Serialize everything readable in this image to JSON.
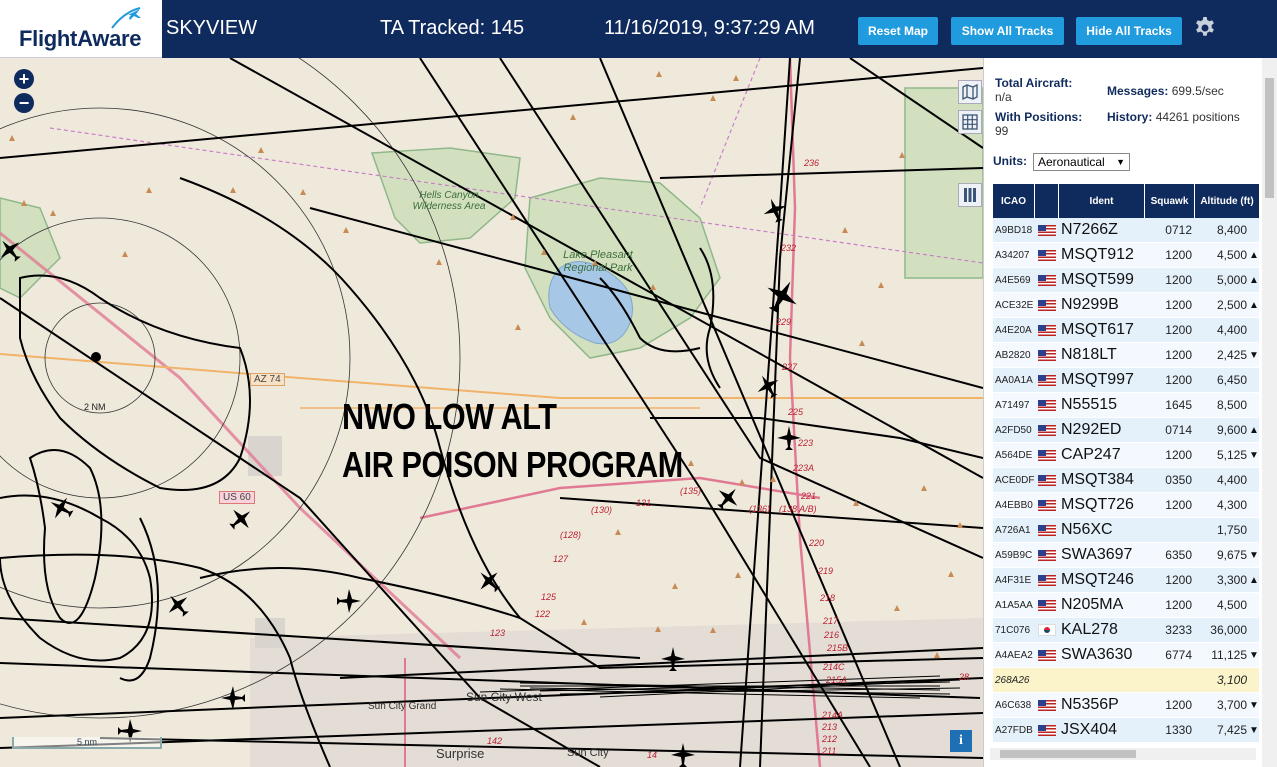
{
  "header": {
    "logo": "FlightAware",
    "app_title": "SKYVIEW",
    "tracked": "TA Tracked: 145",
    "datetime": "11/16/2019, 9:37:29 AM",
    "buttons": {
      "reset_map": "Reset Map",
      "show_all": "Show All Tracks",
      "hide_all": "Hide All Tracks"
    },
    "settings_icon": "gear-icon"
  },
  "map": {
    "overlay_line1": "NWO LOW ALT",
    "overlay_line2": "AIR POISON PROGRAM",
    "scale_label": "5 nm",
    "range_ring_label": "2 NM",
    "info_label": "i",
    "zoom_in": "+",
    "zoom_out": "−",
    "place_labels": [
      "Hells Canyon Wilderness Area",
      "Lake Pleasant Regional Park",
      "Sun City West",
      "Sun City",
      "Surprise",
      "Sun City Grand"
    ],
    "road_labels": [
      "AZ 74",
      "US 60"
    ],
    "altitude_labels": [
      "236",
      "232",
      "229",
      "227",
      "225",
      "223",
      "223A",
      "221",
      "220",
      "219",
      "218",
      "217",
      "216",
      "215B",
      "214C",
      "215A",
      "214A",
      "213",
      "212",
      "211",
      "(130)",
      "131",
      "(135)",
      "(136)",
      "(138 A/B)",
      "(128)",
      "127",
      "125",
      "123",
      "122",
      "142",
      "14",
      "28"
    ],
    "colors": {
      "land": "#efe9dc",
      "water": "#a6c8e6",
      "park": "#c8dab0",
      "track": "#000000",
      "road_pink": "#e07a94",
      "road_orange": "#f1b26a"
    }
  },
  "panel": {
    "total_aircraft_label": "Total Aircraft:",
    "total_aircraft_value": "n/a",
    "with_positions_label": "With Positions:",
    "with_positions_value": "99",
    "messages_label": "Messages:",
    "messages_value": "699.5/sec",
    "history_label": "History:",
    "history_value": "44261 positions",
    "units_label": "Units:",
    "units_value": "Aeronautical",
    "columns": [
      "ICAO",
      "",
      "Ident",
      "Squawk",
      "Altitude (ft)"
    ],
    "rows": [
      {
        "icao": "A9BD18",
        "flag": "us",
        "ident": "N7266Z",
        "squawk": "0712",
        "alt": "8,400",
        "arrow": ""
      },
      {
        "icao": "A34207",
        "flag": "us",
        "ident": "MSQT912",
        "squawk": "1200",
        "alt": "4,500",
        "arrow": "▲"
      },
      {
        "icao": "A4E569",
        "flag": "us",
        "ident": "MSQT599",
        "squawk": "1200",
        "alt": "5,000",
        "arrow": "▲"
      },
      {
        "icao": "ACE32E",
        "flag": "us",
        "ident": "N9299B",
        "squawk": "1200",
        "alt": "2,500",
        "arrow": "▲"
      },
      {
        "icao": "A4E20A",
        "flag": "us",
        "ident": "MSQT617",
        "squawk": "1200",
        "alt": "4,400",
        "arrow": ""
      },
      {
        "icao": "AB2820",
        "flag": "us",
        "ident": "N818LT",
        "squawk": "1200",
        "alt": "2,425",
        "arrow": "▼"
      },
      {
        "icao": "AA0A1A",
        "flag": "us",
        "ident": "MSQT997",
        "squawk": "1200",
        "alt": "6,450",
        "arrow": ""
      },
      {
        "icao": "A71497",
        "flag": "us",
        "ident": "N55515",
        "squawk": "1645",
        "alt": "8,500",
        "arrow": ""
      },
      {
        "icao": "A2FD50",
        "flag": "us",
        "ident": "N292ED",
        "squawk": "0714",
        "alt": "9,600",
        "arrow": "▲"
      },
      {
        "icao": "A564DE",
        "flag": "us",
        "ident": "CAP247",
        "squawk": "1200",
        "alt": "5,125",
        "arrow": "▼"
      },
      {
        "icao": "ACE0DF",
        "flag": "us",
        "ident": "MSQT384",
        "squawk": "0350",
        "alt": "4,400",
        "arrow": ""
      },
      {
        "icao": "A4EBB0",
        "flag": "us",
        "ident": "MSQT726",
        "squawk": "1200",
        "alt": "4,300",
        "arrow": ""
      },
      {
        "icao": "A726A1",
        "flag": "us",
        "ident": "N56XC",
        "squawk": "",
        "alt": "1,750",
        "arrow": ""
      },
      {
        "icao": "A59B9C",
        "flag": "us",
        "ident": "SWA3697",
        "squawk": "6350",
        "alt": "9,675",
        "arrow": "▼"
      },
      {
        "icao": "A4F31E",
        "flag": "us",
        "ident": "MSQT246",
        "squawk": "1200",
        "alt": "3,300",
        "arrow": "▲"
      },
      {
        "icao": "A1A5AA",
        "flag": "us",
        "ident": "N205MA",
        "squawk": "1200",
        "alt": "4,500",
        "arrow": ""
      },
      {
        "icao": "71C076",
        "flag": "kr",
        "ident": "KAL278",
        "squawk": "3233",
        "alt": "36,000",
        "arrow": ""
      },
      {
        "icao": "A4AEA2",
        "flag": "us",
        "ident": "SWA3630",
        "squawk": "6774",
        "alt": "11,125",
        "arrow": "▼"
      },
      {
        "icao": "268A26",
        "flag": "",
        "ident": "",
        "squawk": "",
        "alt": "3,100",
        "arrow": "",
        "highlight": true
      },
      {
        "icao": "A6C638",
        "flag": "us",
        "ident": "N5356P",
        "squawk": "1200",
        "alt": "3,700",
        "arrow": "▼"
      },
      {
        "icao": "A27FDB",
        "flag": "us",
        "ident": "JSX404",
        "squawk": "1330",
        "alt": "7,425",
        "arrow": "▼"
      }
    ]
  }
}
